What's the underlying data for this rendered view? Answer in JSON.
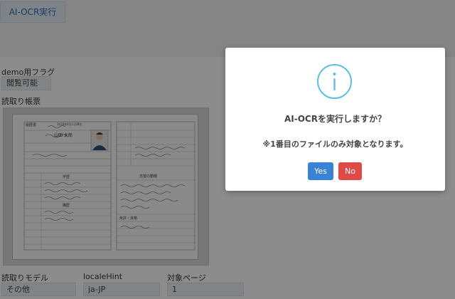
{
  "header": {
    "tab_label": "AI-OCR実行"
  },
  "demo": {
    "label": "demo用フラグ",
    "value": "閲覧可能"
  },
  "form": {
    "label": "読取り帳票"
  },
  "resume": {
    "title": "履歴書",
    "date": "2018年6月1日現在",
    "name": "山田 太郎",
    "section_history": "学歴",
    "section_work": "職歴",
    "section_license": "免許・資格",
    "section_motivation": "志望の動機"
  },
  "fields": {
    "model": {
      "label": "読取りモデル",
      "value": "その他"
    },
    "locale": {
      "label": "localeHint",
      "value": "ja-JP"
    },
    "page": {
      "label": "対象ページ",
      "value": "1"
    }
  },
  "dialog": {
    "icon": "info-icon",
    "title": "AI-OCRを実行しますか？",
    "note": "※1番目のファイルのみ対象となります。",
    "yes_label": "Yes",
    "no_label": "No",
    "accent": "#5bc0de"
  }
}
